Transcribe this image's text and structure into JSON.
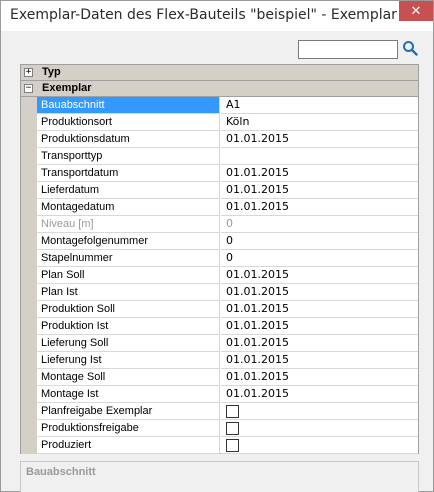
{
  "window": {
    "title": "Exemplar-Daten des Flex-Bauteils \"beispiel\" - Exemplar",
    "close_glyph": "✕"
  },
  "search": {
    "value": "",
    "icon": "search-icon"
  },
  "categories": {
    "typ": {
      "label": "Typ",
      "toggle": "+"
    },
    "exemplar": {
      "label": "Exemplar",
      "toggle": "−"
    }
  },
  "properties": [
    {
      "name": "Bauabschnitt",
      "value": "A1"
    },
    {
      "name": "Produktionsort",
      "value": "Köln"
    },
    {
      "name": "Produktionsdatum",
      "value": "01.01.2015"
    },
    {
      "name": "Transporttyp",
      "value": ""
    },
    {
      "name": "Transportdatum",
      "value": "01.01.2015"
    },
    {
      "name": "Lieferdatum",
      "value": "01.01.2015"
    },
    {
      "name": "Montagedatum",
      "value": "01.01.2015"
    },
    {
      "name": "Niveau [m]",
      "value": "0"
    },
    {
      "name": "Montagefolgenummer",
      "value": "0"
    },
    {
      "name": "Stapelnummer",
      "value": "0"
    },
    {
      "name": "Plan Soll",
      "value": "01.01.2015"
    },
    {
      "name": "Plan Ist",
      "value": "01.01.2015"
    },
    {
      "name": "Produktion Soll",
      "value": "01.01.2015"
    },
    {
      "name": "Produktion Ist",
      "value": "01.01.2015"
    },
    {
      "name": "Lieferung Soll",
      "value": "01.01.2015"
    },
    {
      "name": "Lieferung Ist",
      "value": "01.01.2015"
    },
    {
      "name": "Montage Soll",
      "value": "01.01.2015"
    },
    {
      "name": "Montage Ist",
      "value": "01.01.2015"
    },
    {
      "name": "Planfreigabe Exemplar",
      "checked": false
    },
    {
      "name": "Produktionsfreigabe",
      "checked": false
    },
    {
      "name": "Produziert",
      "checked": false
    }
  ],
  "selected_property": "Bauabschnitt",
  "disabled_property": "Niveau [m]",
  "description": {
    "title": "Bauabschnitt"
  },
  "colors": {
    "selection": "#3399ff",
    "close": "#c75050",
    "category": "#d4d0c8"
  }
}
